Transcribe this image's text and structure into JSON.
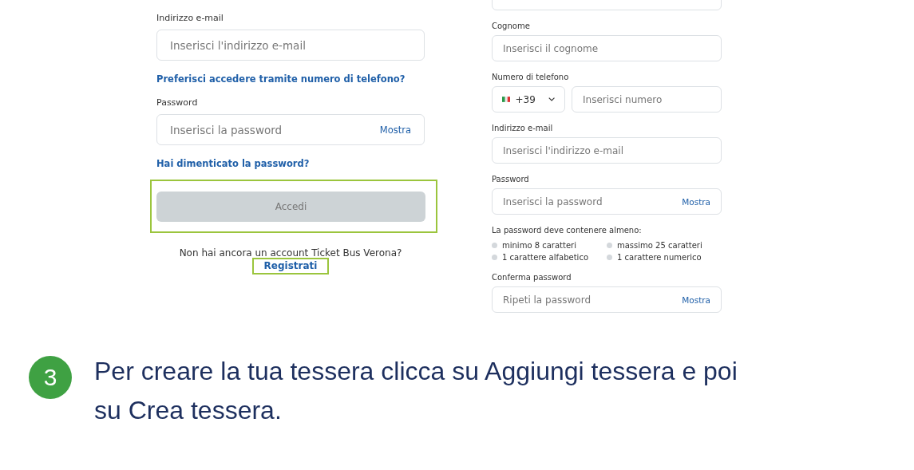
{
  "login_form": {
    "email_label": "Indirizzo e-mail",
    "email_placeholder": "Inserisci l'indirizzo e-mail",
    "phone_link": "Preferisci accedere tramite numero di telefono?",
    "password_label": "Password",
    "password_placeholder": "Inserisci la password",
    "show_label": "Mostra",
    "forgot_link": "Hai dimenticato la password?",
    "submit_button": {
      "label": "Accedi",
      "disabled": true,
      "highlighted": true
    },
    "signup_prompt": "Non hai ancora un account Ticket Bus Verona?",
    "signup_link": {
      "label": "Registrati",
      "highlighted": true
    }
  },
  "register_form": {
    "items": [
      {
        "kind": "field"
      },
      {
        "kind": "field",
        "label": "Cognome",
        "placeholder": "Inserisci il cognome"
      },
      {
        "kind": "phone",
        "label": "Numero di telefono",
        "prefix": "+39",
        "placeholder": "Inserisci numero"
      },
      {
        "kind": "field",
        "label": "Indirizzo e-mail",
        "placeholder": "Inserisci l'indirizzo e-mail"
      },
      {
        "kind": "password",
        "label": "Password",
        "placeholder": "Inserisci la password",
        "show_label": "Mostra"
      },
      {
        "kind": "rules",
        "heading": "La password deve contenere almeno:",
        "rules": [
          {
            "text": "minimo 8 caratteri",
            "met": false
          },
          {
            "text": "massimo 25 caratteri",
            "met": false
          },
          {
            "text": "1 carattere alfabetico",
            "met": false
          },
          {
            "text": "1 carattere numerico",
            "met": false
          }
        ]
      },
      {
        "kind": "password",
        "label": "Conferma password",
        "placeholder": "Ripeti la password",
        "show_label": "Mostra"
      }
    ]
  },
  "step": {
    "number": "3",
    "text": "Per creare la tua tessera clicca su Aggiungi tessera e poi su Crea tessera."
  }
}
